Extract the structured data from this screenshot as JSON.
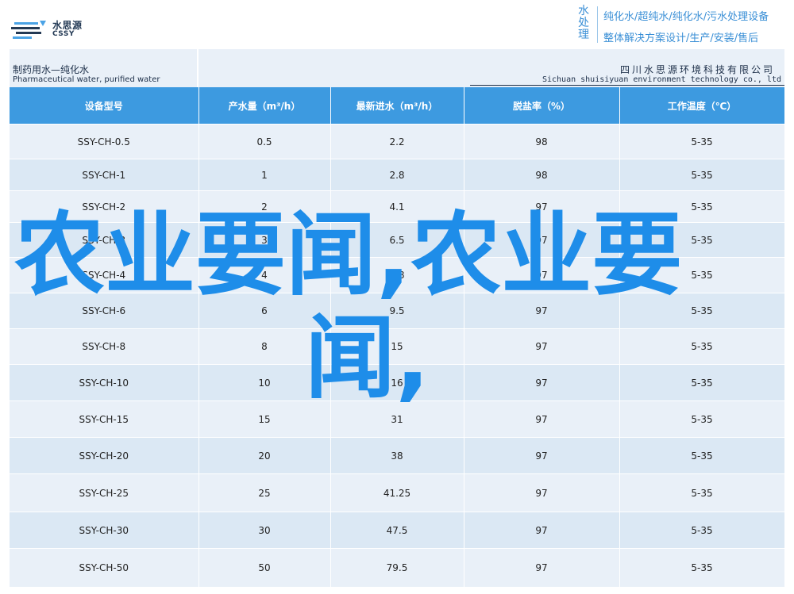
{
  "logo": {
    "cn": "水思源",
    "en": "CSSY"
  },
  "tagline": {
    "head": "水处理",
    "line1": "纯化水/超纯水/纯化水/污水处理设备",
    "line2": "整体解决方案设计/生产/安装/售后"
  },
  "band": {
    "title_cn": "制药用水—纯化水",
    "title_en": "Pharmaceutical water, purified water",
    "company_cn": "四川水思源环境科技有限公司",
    "company_en": "Sichuan shuisiyuan environment technology co., ltd"
  },
  "table": {
    "headers": [
      "设备型号",
      "产水量（m³/h）",
      "最新进水（m³/h）",
      "脱盐率（%）",
      "工作温度（℃）"
    ],
    "rows": [
      [
        "SSY-CH-0.5",
        "0.5",
        "2.2",
        "98",
        "5-35"
      ],
      [
        "SSY-CH-1",
        "1",
        "2.8",
        "98",
        "5-35"
      ],
      [
        "SSY-CH-2",
        "2",
        "4.1",
        "97",
        "5-35"
      ],
      [
        "SSY-CH-3",
        "3",
        "6.5",
        "97",
        "5-35"
      ],
      [
        "SSY-CH-4",
        "4",
        "7.8",
        "97",
        "5-35"
      ],
      [
        "SSY-CH-6",
        "6",
        "9.5",
        "97",
        "5-35"
      ],
      [
        "SSY-CH-8",
        "8",
        "15",
        "97",
        "5-35"
      ],
      [
        "SSY-CH-10",
        "10",
        "16",
        "97",
        "5-35"
      ],
      [
        "SSY-CH-15",
        "15",
        "31",
        "97",
        "5-35"
      ],
      [
        "SSY-CH-20",
        "20",
        "38",
        "97",
        "5-35"
      ],
      [
        "SSY-CH-25",
        "25",
        "41.25",
        "97",
        "5-35"
      ],
      [
        "SSY-CH-30",
        "30",
        "47.5",
        "97",
        "5-35"
      ],
      [
        "SSY-CH-50",
        "50",
        "79.5",
        "97",
        "5-35"
      ]
    ]
  },
  "overlay": {
    "line1": "农业要闻,农业要",
    "line2": "闻,"
  },
  "colors": {
    "header_blue": "#3d9ae0",
    "row_light": "#e9f0f8",
    "row_dark": "#dbe8f4",
    "overlay_blue": "#1e8de9",
    "brand_navy": "#243a55"
  }
}
